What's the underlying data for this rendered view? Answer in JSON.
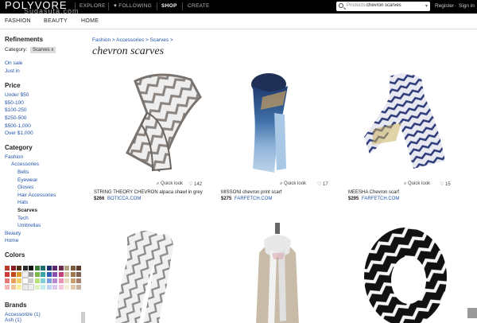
{
  "topbar": {
    "logo": "POLYVORE",
    "logo_sub": "Sudasuta.com",
    "nav": [
      "EXPLORE",
      "FOLLOWING",
      "SHOP",
      "CREATE"
    ],
    "search_category": "Products:",
    "search_query": "chevron scarves",
    "register": "Register",
    "signin": "Sign in"
  },
  "subnav": [
    "FASHION",
    "BEAUTY",
    "HOME"
  ],
  "sidebar": {
    "refinements": "Refinements",
    "category_label": "Category:",
    "category_chip": "Scarves x",
    "flags": [
      "On sale",
      "Just in"
    ],
    "price_title": "Price",
    "prices": [
      "Under $50",
      "$50-100",
      "$100-250",
      "$250-500",
      "$500-1,000",
      "Over $1,000"
    ],
    "category_title": "Category",
    "categories": [
      {
        "label": "Fashion",
        "level": 0
      },
      {
        "label": "Accessories",
        "level": 1
      },
      {
        "label": "Belts",
        "level": 2
      },
      {
        "label": "Eyewear",
        "level": 2
      },
      {
        "label": "Gloves",
        "level": 2
      },
      {
        "label": "Hair Accessories",
        "level": 2
      },
      {
        "label": "Hats",
        "level": 2
      },
      {
        "label": "Scarves",
        "level": 2,
        "current": true
      },
      {
        "label": "Tech",
        "level": 2
      },
      {
        "label": "Umbrellas",
        "level": 2
      },
      {
        "label": "Beauty",
        "level": 0
      },
      {
        "label": "Home",
        "level": 0
      }
    ],
    "colors_title": "Colors",
    "swatch_colors": [
      "#b83a2a",
      "#8a1c1c",
      "#4b2e14",
      "#2d2d2d",
      "#111111",
      "#3a7d3a",
      "#1f6f6f",
      "#1d2f6e",
      "#5b2a6e",
      "#6a2a4e",
      "#b0a080",
      "#7a5b3a",
      "#5a3a2a",
      "#d23a3a",
      "#c04a1a",
      "#d99a2a",
      "#f2f2f2",
      "#999999",
      "#7bb64b",
      "#3aa3a3",
      "#2f5fb7",
      "#8b4fb0",
      "#c0407a",
      "#d0c0a0",
      "#a07850",
      "#806050",
      "#e67a7a",
      "#e8a05a",
      "#f0d060",
      "#ffffff",
      "#cccccc",
      "#b6e07a",
      "#7fd0d0",
      "#7aa0e0",
      "#b88ad0",
      "#e890b8",
      "#e8dcc0",
      "#c8a070",
      "#a88070",
      "#f4b8b8",
      "#f2c89a",
      "#f8ec9a",
      "#e8e8e8",
      "#eeeeee",
      "#dff0c0",
      "#c0ecec",
      "#c0d4f4",
      "#dcc8ec",
      "#f4c8dc",
      "#f4eedc",
      "#e0c8a8",
      "#c8b0a0"
    ],
    "brands_title": "Brands",
    "brands": [
      "Accessorize (1)",
      "Ash (1)"
    ]
  },
  "main": {
    "breadcrumb": "Fashion > Accessories > Scarves >",
    "title": "chevron scarves",
    "quick_look": "Quick look",
    "products": [
      {
        "name": "STRING THEORY CHEVRON alpaca shawl in grey",
        "price": "$266",
        "store": "BOTICCA.COM",
        "likes": "142"
      },
      {
        "name": "MISSONI chevron print scarf",
        "price": "$275",
        "store": "FARFETCH.COM",
        "likes": "17"
      },
      {
        "name": "MEESHA Chevron scarf",
        "price": "$295",
        "store": "FARFETCH.COM",
        "likes": "15"
      },
      {
        "name": "",
        "price": "",
        "store": "",
        "likes": ""
      },
      {
        "name": "",
        "price": "",
        "store": "",
        "likes": ""
      },
      {
        "name": "",
        "price": "",
        "store": "",
        "likes": ""
      }
    ]
  },
  "colors": {
    "link": "#2255aa",
    "topbar": "#000000"
  }
}
